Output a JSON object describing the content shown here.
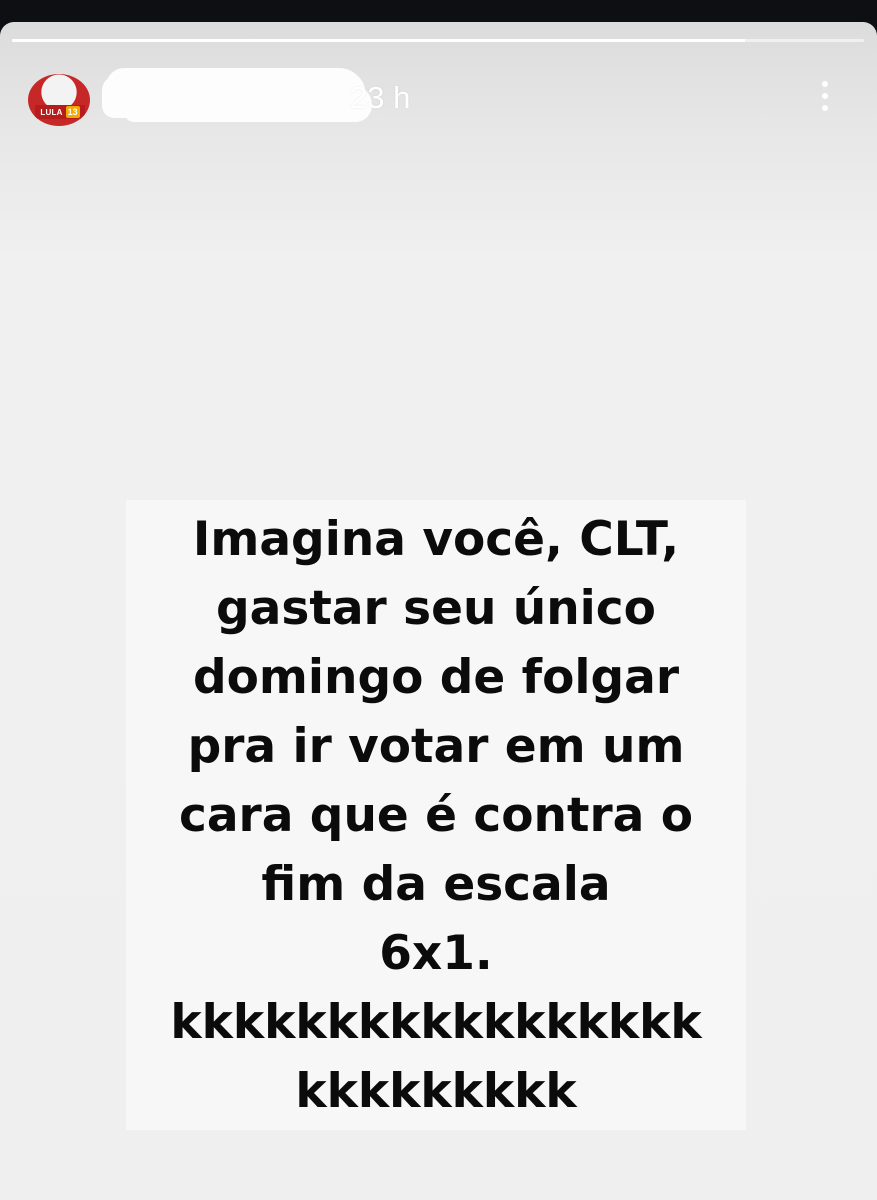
{
  "story": {
    "progress_fraction": 0.86,
    "header": {
      "avatar_badge_name": "LULA",
      "avatar_badge_number": "13",
      "timestamp": "23 h",
      "more_icon": "vertical-ellipsis-icon"
    },
    "post": {
      "lines": [
        "Imagina você, CLT,",
        "gastar seu único",
        "domingo de folgar",
        "pra ir votar em um",
        "cara que é contra o",
        "fim da escala",
        "6x1.",
        "kkkkkkkkkkkkkkkkk",
        "kkkkkkkkk"
      ]
    }
  },
  "colors": {
    "background_dark": "#0d0f12",
    "story_background": "#efefef",
    "text": "#0b0b0b",
    "avatar_red": "#c62828"
  }
}
